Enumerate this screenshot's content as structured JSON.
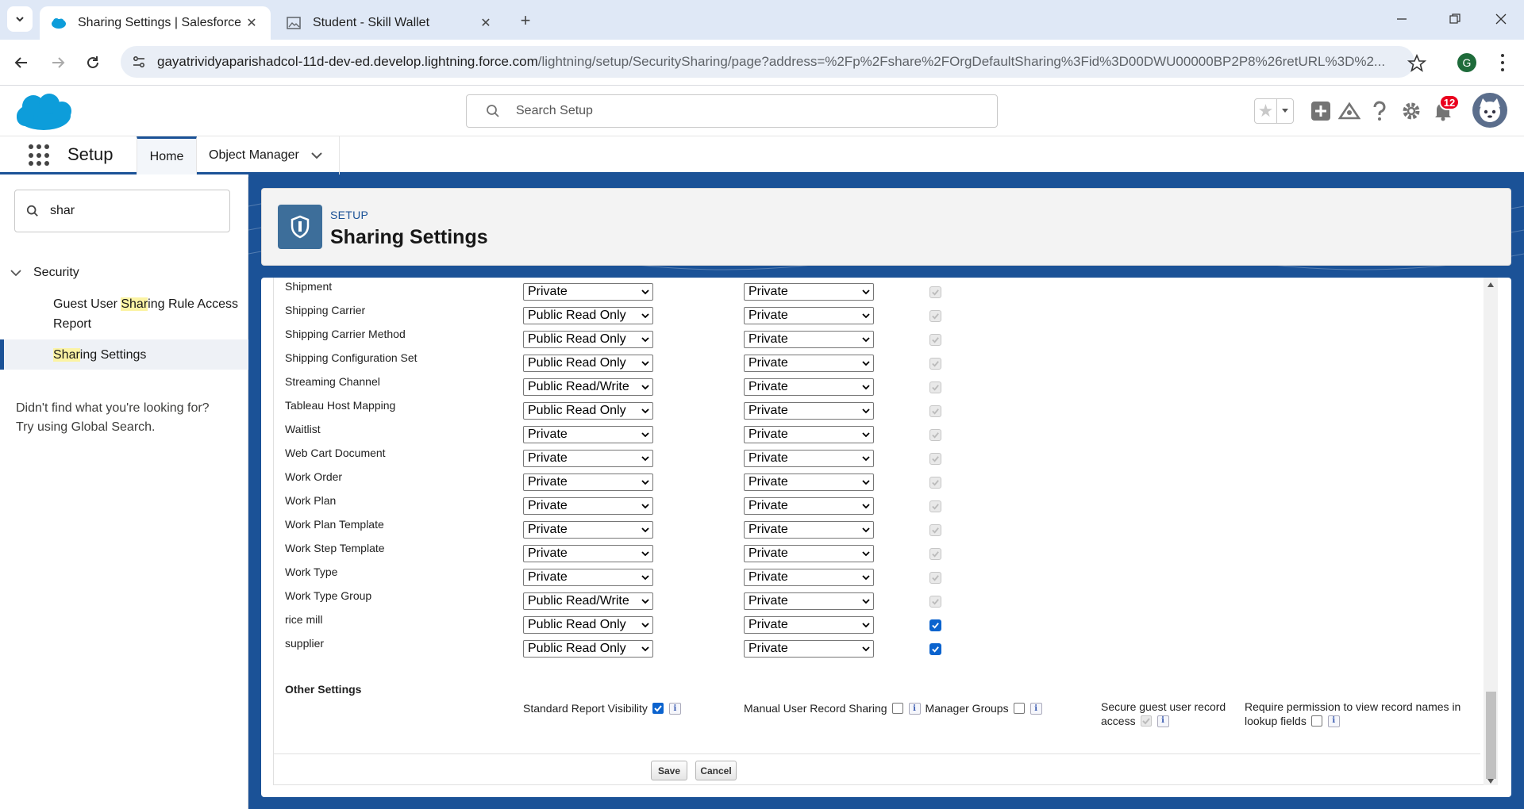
{
  "browser": {
    "tabs": [
      {
        "title": "Sharing Settings | Salesforce",
        "active": true,
        "icon": "salesforce-cloud-icon"
      },
      {
        "title": "Student - Skill Wallet",
        "active": false,
        "icon": "image-icon"
      }
    ],
    "url_host": "gayatrividyaparishadcol-11d-dev-ed.develop.lightning.force.com",
    "url_path": "/lightning/setup/SecuritySharing/page?address=%2Fp%2Fshare%2FOrgDefaultSharing%3Fid%3D00DWU00000BP2P8%26retURL%3D%2...",
    "profile_initial": "G"
  },
  "header": {
    "search_placeholder": "Search Setup",
    "notification_count": "12"
  },
  "appnav": {
    "app_name": "Setup",
    "tabs": [
      {
        "label": "Home"
      },
      {
        "label": "Object Manager"
      }
    ]
  },
  "sidebar": {
    "quick_find_value": "shar",
    "section": "Security",
    "items": [
      {
        "pre": "Guest User ",
        "hl": "Shar",
        "post": "ing Rule Access",
        "line2": "Report"
      },
      {
        "pre": "",
        "hl": "Shar",
        "post": "ing Settings",
        "selected": true
      }
    ],
    "help_line1": "Didn't find what you're looking for?",
    "help_line2": "Try using Global Search."
  },
  "page": {
    "eyebrow": "SETUP",
    "title": "Sharing Settings"
  },
  "defaults_table": {
    "rows": [
      {
        "name": "Shipment",
        "internal": "Private",
        "external": "Private",
        "grant": "disabled"
      },
      {
        "name": "Shipping Carrier",
        "internal": "Public Read Only",
        "external": "Private",
        "grant": "disabled"
      },
      {
        "name": "Shipping Carrier Method",
        "internal": "Public Read Only",
        "external": "Private",
        "grant": "disabled"
      },
      {
        "name": "Shipping Configuration Set",
        "internal": "Public Read Only",
        "external": "Private",
        "grant": "disabled"
      },
      {
        "name": "Streaming Channel",
        "internal": "Public Read/Write",
        "external": "Private",
        "grant": "disabled"
      },
      {
        "name": "Tableau Host Mapping",
        "internal": "Public Read Only",
        "external": "Private",
        "grant": "disabled"
      },
      {
        "name": "Waitlist",
        "internal": "Private",
        "external": "Private",
        "grant": "disabled"
      },
      {
        "name": "Web Cart Document",
        "internal": "Private",
        "external": "Private",
        "grant": "disabled"
      },
      {
        "name": "Work Order",
        "internal": "Private",
        "external": "Private",
        "grant": "disabled"
      },
      {
        "name": "Work Plan",
        "internal": "Private",
        "external": "Private",
        "grant": "disabled"
      },
      {
        "name": "Work Plan Template",
        "internal": "Private",
        "external": "Private",
        "grant": "disabled"
      },
      {
        "name": "Work Step Template",
        "internal": "Private",
        "external": "Private",
        "grant": "disabled"
      },
      {
        "name": "Work Type",
        "internal": "Private",
        "external": "Private",
        "grant": "disabled"
      },
      {
        "name": "Work Type Group",
        "internal": "Public Read/Write",
        "external": "Private",
        "grant": "disabled"
      },
      {
        "name": "rice mill",
        "internal": "Public Read Only",
        "external": "Private",
        "grant": "checked"
      },
      {
        "name": "supplier",
        "internal": "Public Read Only",
        "external": "Private",
        "grant": "checked"
      }
    ]
  },
  "other_settings": {
    "title": "Other Settings",
    "standard_report_visibility": "Standard Report Visibility",
    "manual_user_record_sharing": "Manual User Record Sharing",
    "manager_groups": "Manager Groups",
    "secure_guest_line1": "Secure guest user record",
    "secure_guest_line2": "access",
    "require_perm_line1": "Require permission to view record names in",
    "require_perm_line2": "lookup fields",
    "info_glyph": "i"
  },
  "buttons": {
    "save": "Save",
    "cancel": "Cancel"
  }
}
